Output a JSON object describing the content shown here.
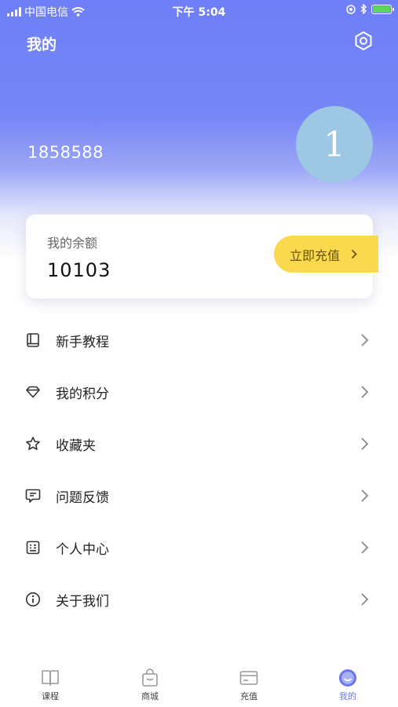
{
  "status_bar": {
    "carrier": "中国电信",
    "time": "下午 5:04"
  },
  "header": {
    "title": "我的",
    "username": "1858588",
    "avatar_text": "1"
  },
  "balance": {
    "label": "我的余额",
    "value": "10103",
    "recharge_label": "立即充值"
  },
  "menu": [
    {
      "label": "新手教程",
      "icon": "book-icon"
    },
    {
      "label": "我的积分",
      "icon": "diamond-icon"
    },
    {
      "label": "收藏夹",
      "icon": "star-icon"
    },
    {
      "label": "问题反馈",
      "icon": "feedback-icon"
    },
    {
      "label": "个人中心",
      "icon": "profile-card-icon"
    },
    {
      "label": "关于我们",
      "icon": "info-icon"
    }
  ],
  "tabs": [
    {
      "label": "课程",
      "icon": "course-book-icon",
      "active": false
    },
    {
      "label": "商城",
      "icon": "shopping-bag-icon",
      "active": false
    },
    {
      "label": "充值",
      "icon": "card-icon",
      "active": false
    },
    {
      "label": "我的",
      "icon": "smiley-icon",
      "active": true
    }
  ],
  "colors": {
    "header": "#7281f7",
    "accent": "#6a78ef",
    "recharge_button": "#fad94e",
    "avatar": "#9ec7e3"
  }
}
